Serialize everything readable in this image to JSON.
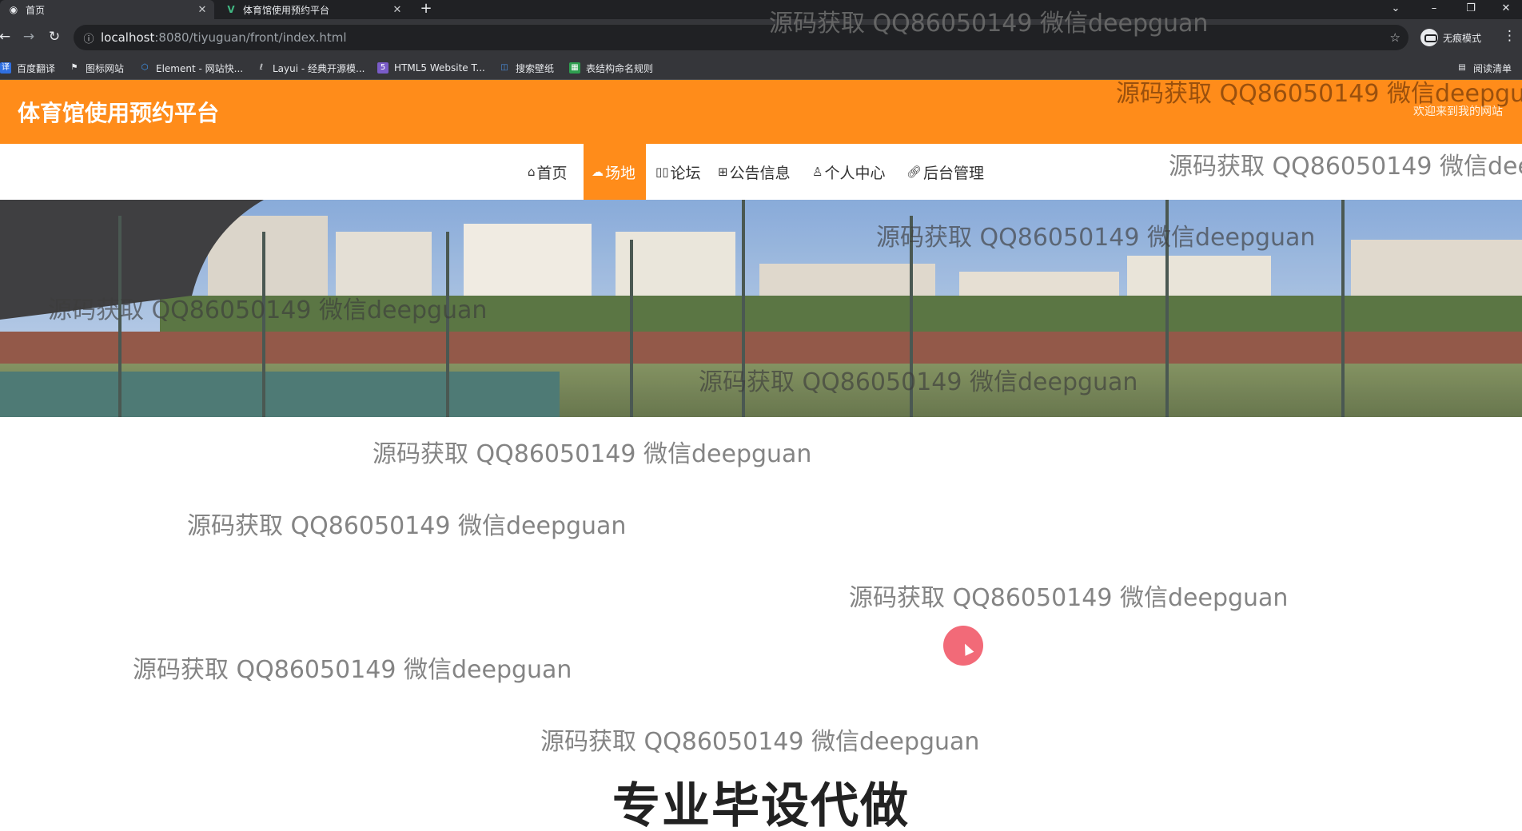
{
  "browser": {
    "tabs": [
      {
        "title": "首页",
        "active": true,
        "icon": "globe-icon"
      },
      {
        "title": "体育馆使用预约平台",
        "active": false,
        "icon": "vue-logo-icon"
      }
    ],
    "new_tab_label": "+",
    "url_host": "localhost",
    "url_path": ":8080/tiyuguan/front/index.html",
    "profile_label": "无痕模式",
    "bookmarks": [
      {
        "label": "百度翻译",
        "icon": "translate-icon",
        "color": "#2f6fe0"
      },
      {
        "label": "图标网站",
        "icon": "flag-icon",
        "color": "#e8eaed"
      },
      {
        "label": "Element - 网站快...",
        "icon": "element-icon",
        "color": "#409eff"
      },
      {
        "label": "Layui - 经典开源模...",
        "icon": "layui-icon",
        "color": "#e8eaed"
      },
      {
        "label": "HTML5 Website T...",
        "icon": "html5-icon",
        "color": "#7a5cc9"
      },
      {
        "label": "搜索壁纸",
        "icon": "wallpaper-icon",
        "color": "#4a90e2"
      },
      {
        "label": "表结构命名规则",
        "icon": "sheet-icon",
        "color": "#2e9e4f"
      }
    ],
    "reading_list_label": "阅读清单"
  },
  "site": {
    "title": "体育馆使用预约平台",
    "welcome": "欢迎来到我的网站",
    "accent_color": "#ff8c1a",
    "nav": [
      {
        "label": "首页",
        "icon": "home-icon",
        "active": false
      },
      {
        "label": "场地",
        "icon": "cloud-icon",
        "active": true
      },
      {
        "label": "论坛",
        "icon": "forum-icon",
        "active": false
      },
      {
        "label": "公告信息",
        "icon": "notice-icon",
        "active": false
      },
      {
        "label": "个人中心",
        "icon": "user-icon",
        "active": false
      },
      {
        "label": "后台管理",
        "icon": "link-icon",
        "active": false
      }
    ]
  },
  "watermark_text": "源码获取 QQ86050149 微信deepguan",
  "promo_text": "专业毕设代做"
}
